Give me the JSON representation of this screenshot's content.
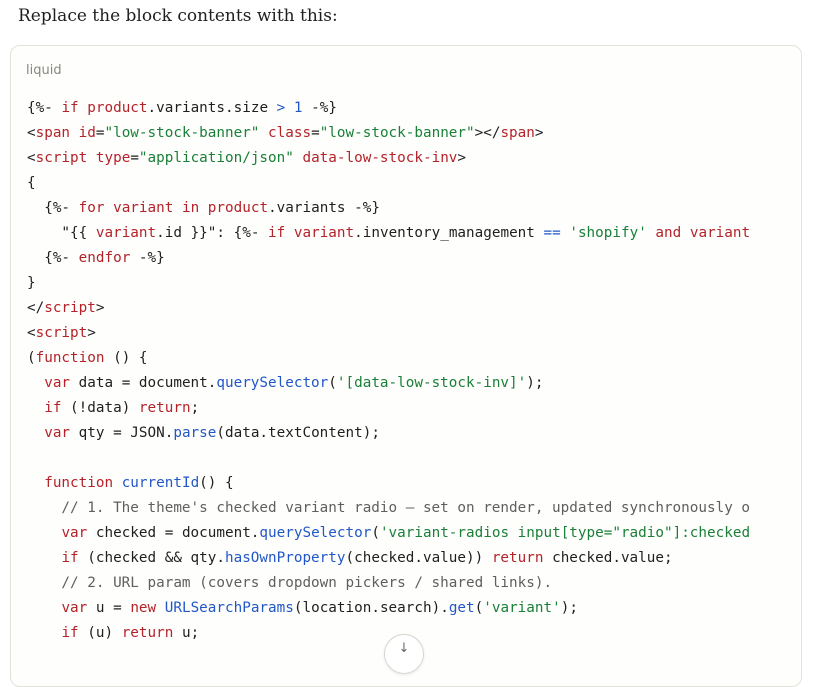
{
  "message": {
    "intro": "Replace the block contents with this:"
  },
  "code_block": {
    "language": "liquid",
    "lines": [
      [
        [
          "p",
          "{%- "
        ],
        [
          "kw",
          "if"
        ],
        [
          "p",
          " "
        ],
        [
          "kw",
          "product"
        ],
        [
          "p",
          "."
        ],
        [
          "p",
          "variants"
        ],
        [
          "p",
          "."
        ],
        [
          "p",
          "size "
        ],
        [
          "num",
          ">"
        ],
        [
          "p",
          " "
        ],
        [
          "num",
          "1"
        ],
        [
          "p",
          " -%}"
        ]
      ],
      [
        [
          "p",
          "<"
        ],
        [
          "kw",
          "span"
        ],
        [
          "p",
          " "
        ],
        [
          "kw",
          "id"
        ],
        [
          "p",
          "="
        ],
        [
          "str",
          "\"low-stock-banner\""
        ],
        [
          "p",
          " "
        ],
        [
          "kw",
          "class"
        ],
        [
          "p",
          "="
        ],
        [
          "str",
          "\"low-stock-banner\""
        ],
        [
          "p",
          "></"
        ],
        [
          "kw",
          "span"
        ],
        [
          "p",
          ">"
        ]
      ],
      [
        [
          "p",
          "<"
        ],
        [
          "kw",
          "script"
        ],
        [
          "p",
          " "
        ],
        [
          "kw",
          "type"
        ],
        [
          "p",
          "="
        ],
        [
          "str",
          "\"application/json\""
        ],
        [
          "p",
          " "
        ],
        [
          "kw",
          "data-low-stock-inv"
        ],
        [
          "p",
          ">"
        ]
      ],
      [
        [
          "p",
          "{"
        ]
      ],
      [
        [
          "p",
          "  {%- "
        ],
        [
          "kw",
          "for"
        ],
        [
          "p",
          " "
        ],
        [
          "kw",
          "variant"
        ],
        [
          "p",
          " "
        ],
        [
          "kw",
          "in"
        ],
        [
          "p",
          " "
        ],
        [
          "kw",
          "product"
        ],
        [
          "p",
          "."
        ],
        [
          "p",
          "variants -%}"
        ]
      ],
      [
        [
          "p",
          "    \"{{ "
        ],
        [
          "kw",
          "variant"
        ],
        [
          "p",
          "."
        ],
        [
          "p",
          "id }}\": {%- "
        ],
        [
          "kw",
          "if"
        ],
        [
          "p",
          " "
        ],
        [
          "kw",
          "variant"
        ],
        [
          "p",
          "."
        ],
        [
          "p",
          "inventory_management "
        ],
        [
          "fn",
          "=="
        ],
        [
          "p",
          " "
        ],
        [
          "str",
          "'shopify'"
        ],
        [
          "p",
          " "
        ],
        [
          "kw",
          "and"
        ],
        [
          "p",
          " "
        ],
        [
          "kw",
          "variant"
        ]
      ],
      [
        [
          "p",
          "  {%- "
        ],
        [
          "kw",
          "endfor"
        ],
        [
          "p",
          " -%}"
        ]
      ],
      [
        [
          "p",
          "}"
        ]
      ],
      [
        [
          "p",
          "</"
        ],
        [
          "kw",
          "script"
        ],
        [
          "p",
          ">"
        ]
      ],
      [
        [
          "p",
          "<"
        ],
        [
          "kw",
          "script"
        ],
        [
          "p",
          ">"
        ]
      ],
      [
        [
          "p",
          "("
        ],
        [
          "kw",
          "function"
        ],
        [
          "p",
          " () {"
        ]
      ],
      [
        [
          "p",
          "  "
        ],
        [
          "kw",
          "var"
        ],
        [
          "p",
          " data = document."
        ],
        [
          "fn",
          "querySelector"
        ],
        [
          "p",
          "("
        ],
        [
          "str",
          "'[data-low-stock-inv]'"
        ],
        [
          "p",
          ");"
        ]
      ],
      [
        [
          "p",
          "  "
        ],
        [
          "kw",
          "if"
        ],
        [
          "p",
          " (!data) "
        ],
        [
          "kw",
          "return"
        ],
        [
          "p",
          ";"
        ]
      ],
      [
        [
          "p",
          "  "
        ],
        [
          "kw",
          "var"
        ],
        [
          "p",
          " qty = JSON."
        ],
        [
          "fn",
          "parse"
        ],
        [
          "p",
          "(data.textContent);"
        ]
      ],
      [
        [
          "p",
          ""
        ]
      ],
      [
        [
          "p",
          "  "
        ],
        [
          "kw",
          "function"
        ],
        [
          "p",
          " "
        ],
        [
          "fn",
          "currentId"
        ],
        [
          "p",
          "() {"
        ]
      ],
      [
        [
          "cm",
          "    // 1. The theme's checked variant radio — set on render, updated synchronously o"
        ]
      ],
      [
        [
          "p",
          "    "
        ],
        [
          "kw",
          "var"
        ],
        [
          "p",
          " checked = document."
        ],
        [
          "fn",
          "querySelector"
        ],
        [
          "p",
          "("
        ],
        [
          "str",
          "'variant-radios input[type=\"radio\"]:checked"
        ]
      ],
      [
        [
          "p",
          "    "
        ],
        [
          "kw",
          "if"
        ],
        [
          "p",
          " (checked && qty."
        ],
        [
          "fn",
          "hasOwnProperty"
        ],
        [
          "p",
          "(checked.value)) "
        ],
        [
          "kw",
          "return"
        ],
        [
          "p",
          " checked.value;"
        ]
      ],
      [
        [
          "cm",
          "    // 2. URL param (covers dropdown pickers / shared links)."
        ]
      ],
      [
        [
          "p",
          "    "
        ],
        [
          "kw",
          "var"
        ],
        [
          "p",
          " u = "
        ],
        [
          "kw",
          "new"
        ],
        [
          "p",
          " "
        ],
        [
          "fn",
          "URLSearchParams"
        ],
        [
          "p",
          "(location.search)."
        ],
        [
          "fn",
          "get"
        ],
        [
          "p",
          "("
        ],
        [
          "str",
          "'variant'"
        ],
        [
          "p",
          ");"
        ]
      ],
      [
        [
          "p",
          "    "
        ],
        [
          "kw",
          "if"
        ],
        [
          "p",
          " (u) "
        ],
        [
          "kw",
          "return"
        ],
        [
          "p",
          " u;"
        ]
      ]
    ]
  },
  "scroll_button": {
    "icon": "arrow-down-icon",
    "glyph": "↓"
  }
}
